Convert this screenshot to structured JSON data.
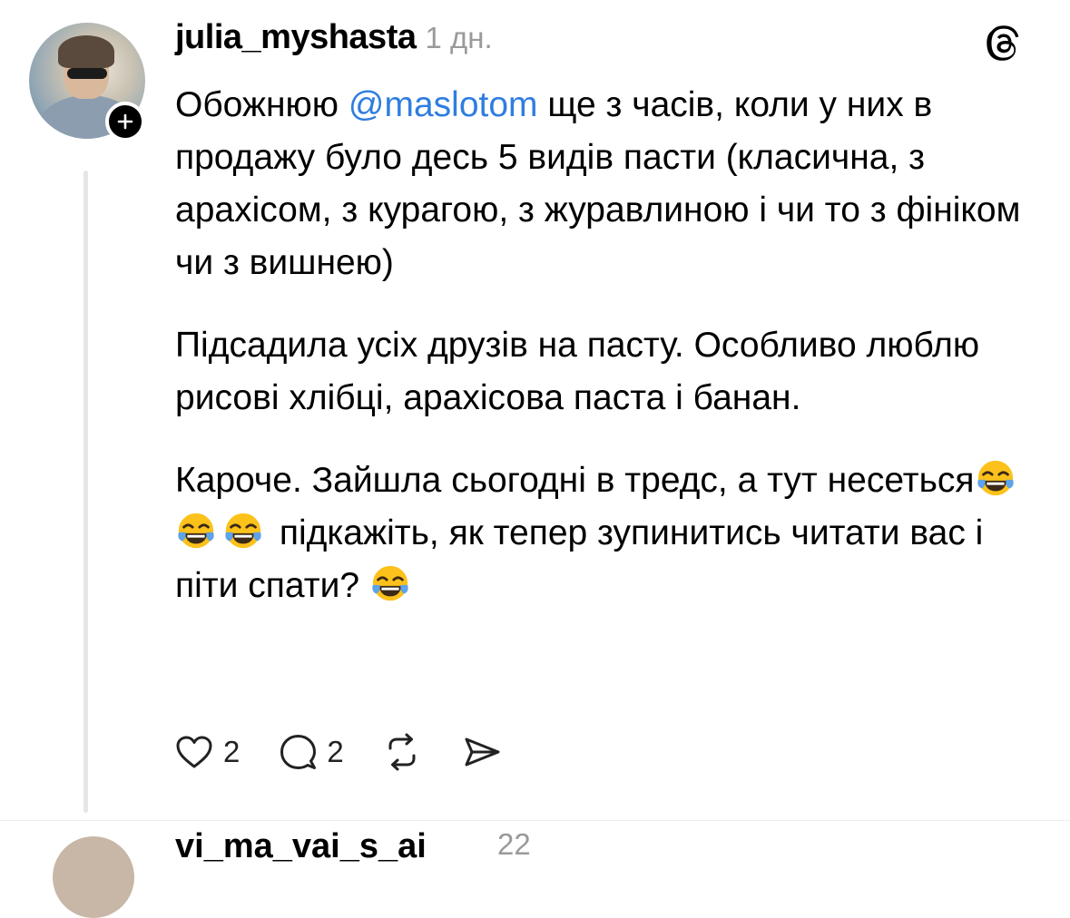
{
  "post": {
    "username": "julia_myshasta",
    "timestamp": "1 дн.",
    "paragraphs": [
      {
        "before": "Обожнюю ",
        "mention": "@maslotom",
        "after": " ще з часів, коли у них в продажу було десь 5 видів пасти (класична, з арахісом, з курагою, з журавлиною і чи то з фініком чи з вишнею)"
      },
      {
        "text": "Підсадила усіх друзів на пасту. Особливо люблю рисові хлібці, арахісова паста і банан."
      },
      {
        "part1": "Кароче. Зайшла сьогодні в тредс, а тут несеться",
        "part2": " підкажіть, як тепер зупинитись читати вас і піти спати? "
      }
    ],
    "emoji": "face-with-tears-of-joy",
    "likes": "2",
    "replies": "2"
  },
  "next_post": {
    "username": "vi_ma_vai_s_ai",
    "timestamp": "22"
  },
  "icons": {
    "like": "heart-icon",
    "reply": "comment-icon",
    "repost": "repost-icon",
    "share": "send-icon",
    "app": "threads-logo-icon",
    "follow": "plus-icon"
  },
  "colors": {
    "mention": "#2f7de1",
    "muted": "#9a9a9a",
    "thread_line": "#e6e6e6"
  }
}
